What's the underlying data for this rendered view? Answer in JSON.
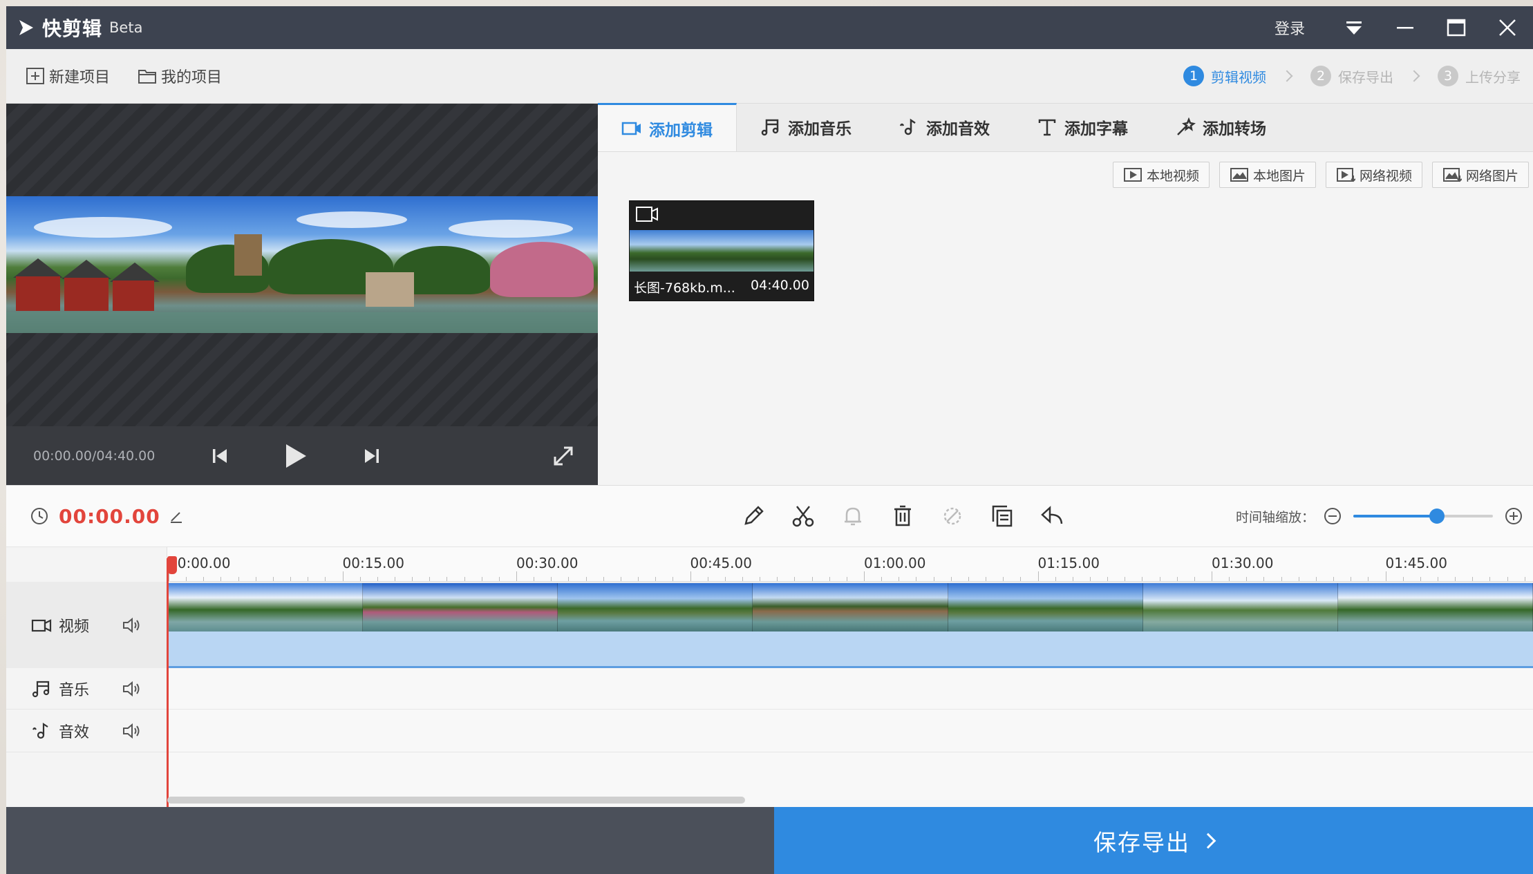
{
  "titlebar": {
    "app_name": "快剪辑",
    "beta": "Beta",
    "login": "登录"
  },
  "menubar": {
    "new_project": "新建项目",
    "my_projects": "我的项目",
    "steps": [
      {
        "num": "1",
        "label": "剪辑视频"
      },
      {
        "num": "2",
        "label": "保存导出"
      },
      {
        "num": "3",
        "label": "上传分享"
      }
    ]
  },
  "preview": {
    "timecode": "00:00.00/04:40.00"
  },
  "tabs": [
    {
      "label": "添加剪辑"
    },
    {
      "label": "添加音乐"
    },
    {
      "label": "添加音效"
    },
    {
      "label": "添加字幕"
    },
    {
      "label": "添加转场"
    }
  ],
  "sources": [
    {
      "label": "本地视频"
    },
    {
      "label": "本地图片"
    },
    {
      "label": "网络视频"
    },
    {
      "label": "网络图片"
    }
  ],
  "clip": {
    "name": "长图-768kb.m...",
    "duration": "04:40.00"
  },
  "toolbar": {
    "current_time": "00:00.00",
    "zoom_label": "时间轴缩放：",
    "zoom_level": 0.6
  },
  "ruler": {
    "ticks": [
      "00:00.00",
      "00:15.00",
      "00:30.00",
      "00:45.00",
      "01:00.00",
      "01:15.00",
      "01:30.00",
      "01:45.00"
    ]
  },
  "tracks": {
    "video": "视频",
    "music": "音乐",
    "effect": "音效"
  },
  "export": {
    "label": "保存导出"
  },
  "colors": {
    "accent": "#2f8ae0",
    "timecode_red": "#e2453c",
    "titlebar": "#3d4350"
  }
}
